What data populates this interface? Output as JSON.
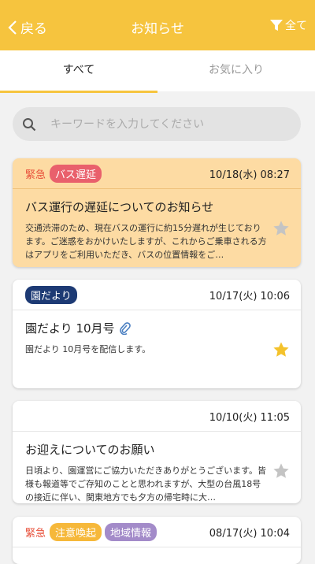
{
  "header": {
    "back_label": "戻る",
    "title": "お知らせ",
    "filter_label": "全て"
  },
  "tabs": [
    {
      "label": "すべて",
      "active": true
    },
    {
      "label": "お気に入り",
      "active": false
    }
  ],
  "search": {
    "placeholder": "キーワードを入力してください",
    "value": ""
  },
  "colors": {
    "accent": "#f6c43e",
    "urgent_bg": "#fddba3",
    "urgent_text": "#e8503a"
  },
  "notices": [
    {
      "urgent_label": "緊急",
      "tags": [
        {
          "label": "バス遅延",
          "color": "#e9606c"
        }
      ],
      "date": "10/18(水) 08:27",
      "title": "バス運行の遅延についてのお知らせ",
      "text": "交通渋滞のため、現在バスの運行に約15分遅れが生じております。ご迷惑をおかけいたしますが、これからご乗車される方はアプリをご利用いただき、バスの位置情報をご…",
      "favorite": false,
      "attachment": false
    },
    {
      "urgent_label": "",
      "tags": [
        {
          "label": "園だより",
          "color": "#1d3a74"
        }
      ],
      "date": "10/17(火) 10:06",
      "title": "園だより 10月号",
      "text": "園だより 10月号を配信します。",
      "favorite": true,
      "attachment": true
    },
    {
      "urgent_label": "",
      "tags": [],
      "date": "10/10(火) 11:05",
      "title": "お迎えについてのお願い",
      "text": "日頃より、園運営にご協力いただきありがとうございます。皆様も報道等でご存知のことと思われますが、大型の台風18号の接近に伴い、関東地方でも夕方の帰宅時に大…",
      "favorite": false,
      "attachment": false
    },
    {
      "urgent_label": "緊急",
      "tags": [
        {
          "label": "注意喚起",
          "color": "#f6b83a"
        },
        {
          "label": "地域情報",
          "color": "#a38bc9"
        }
      ],
      "date": "08/17(火) 10:04",
      "title": "",
      "text": "",
      "favorite": false,
      "attachment": false
    }
  ]
}
